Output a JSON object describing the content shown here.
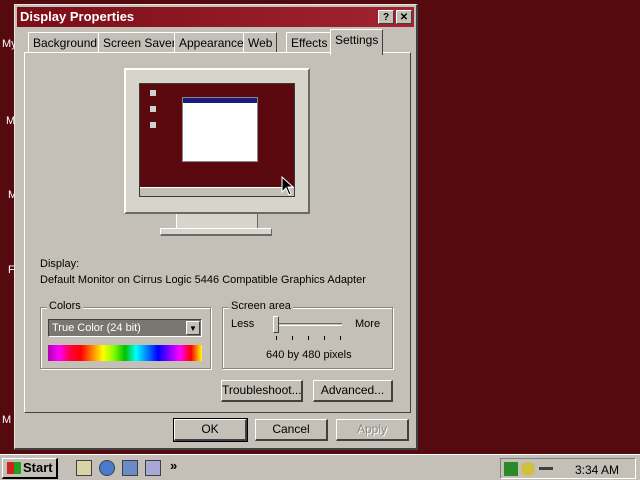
{
  "desktop": {
    "left_chars": [
      "My",
      "M",
      "M",
      "F",
      "M"
    ]
  },
  "window": {
    "title": "Display Properties",
    "help_button": "?",
    "close_button": "✕",
    "tabs": [
      {
        "label": "Background"
      },
      {
        "label": "Screen Saver"
      },
      {
        "label": "Appearance"
      },
      {
        "label": "Web"
      },
      {
        "label": "Effects"
      },
      {
        "label": "Settings",
        "active": true
      }
    ],
    "display_label": "Display:",
    "display_value": "Default Monitor on Cirrus Logic 5446 Compatible Graphics Adapter",
    "colors": {
      "legend": "Colors",
      "selected": "True Color (24 bit)"
    },
    "screen_area": {
      "legend": "Screen area",
      "less": "Less",
      "more": "More",
      "value_text": "640 by 480 pixels",
      "slider_position": 0
    },
    "buttons": {
      "troubleshoot": "Troubleshoot...",
      "advanced": "Advanced...",
      "ok": "OK",
      "cancel": "Cancel",
      "apply": "Apply"
    }
  },
  "taskbar": {
    "start_label": "Start",
    "quicklaunch_icons": [
      "show-desktop-icon",
      "internet-explorer-icon",
      "outlook-express-icon",
      "channels-icon"
    ],
    "chevron": "»",
    "clock": "3:34 AM"
  },
  "colors": {
    "desktop": "#550a10",
    "title_bar": "#7a0d16",
    "face": "#c4c0b8"
  }
}
